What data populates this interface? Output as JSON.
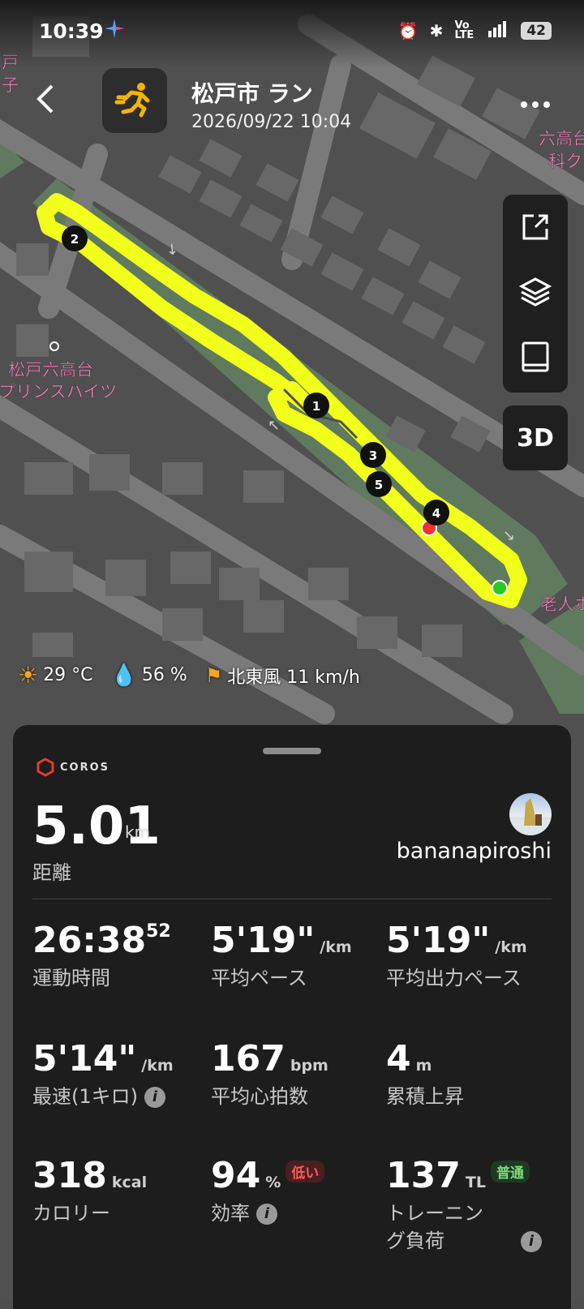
{
  "status_bar": {
    "time": "10:39",
    "battery": "42"
  },
  "header": {
    "title": "松戸市 ラン",
    "datetime": "2026/09/22 10:04"
  },
  "map": {
    "labels": {
      "place_1": "松戸六高台",
      "place_2": "プリンスハイツ",
      "top_right_1": "六高台",
      "top_right_2": "科ク",
      "right_edge": "老人ホ",
      "top_left_1": "戸",
      "top_left_2": "子"
    },
    "laps": [
      "1",
      "2",
      "3",
      "4",
      "5"
    ],
    "route_color": "#f2ff1a",
    "start_color": "#22cc22",
    "end_color": "#ee3333",
    "view_3d_label": "3D"
  },
  "weather": {
    "temperature": "29 °C",
    "humidity": "56 %",
    "wind": "北東風 11 km/h"
  },
  "panel": {
    "brand": "COROS",
    "distance": {
      "value": "5.01",
      "unit": "km",
      "label": "距離"
    },
    "username": "bananapiroshi",
    "metrics": {
      "duration": {
        "value": "26:38",
        "sup": "52",
        "label": "運動時間"
      },
      "avg_pace": {
        "value": "5'19\"",
        "unit": "/km",
        "label": "平均ペース"
      },
      "avg_power_pace": {
        "value": "5'19\"",
        "unit": "/km",
        "label": "平均出力ペース"
      },
      "fastest_km": {
        "value": "5'14\"",
        "unit": "/km",
        "label": "最速(1キロ)"
      },
      "avg_hr": {
        "value": "167",
        "unit": "bpm",
        "label": "平均心拍数"
      },
      "elev_gain": {
        "value": "4",
        "unit": "m",
        "label": "累積上昇"
      },
      "calories": {
        "value": "318",
        "unit": "kcal",
        "label": "カロリー"
      },
      "efficiency": {
        "value": "94",
        "unit": "%",
        "badge": "低い",
        "label": "効率"
      },
      "training_load": {
        "value": "137",
        "unit": "TL",
        "badge": "普通",
        "label_1": "トレーニン",
        "label_2": "グ負荷"
      }
    }
  }
}
